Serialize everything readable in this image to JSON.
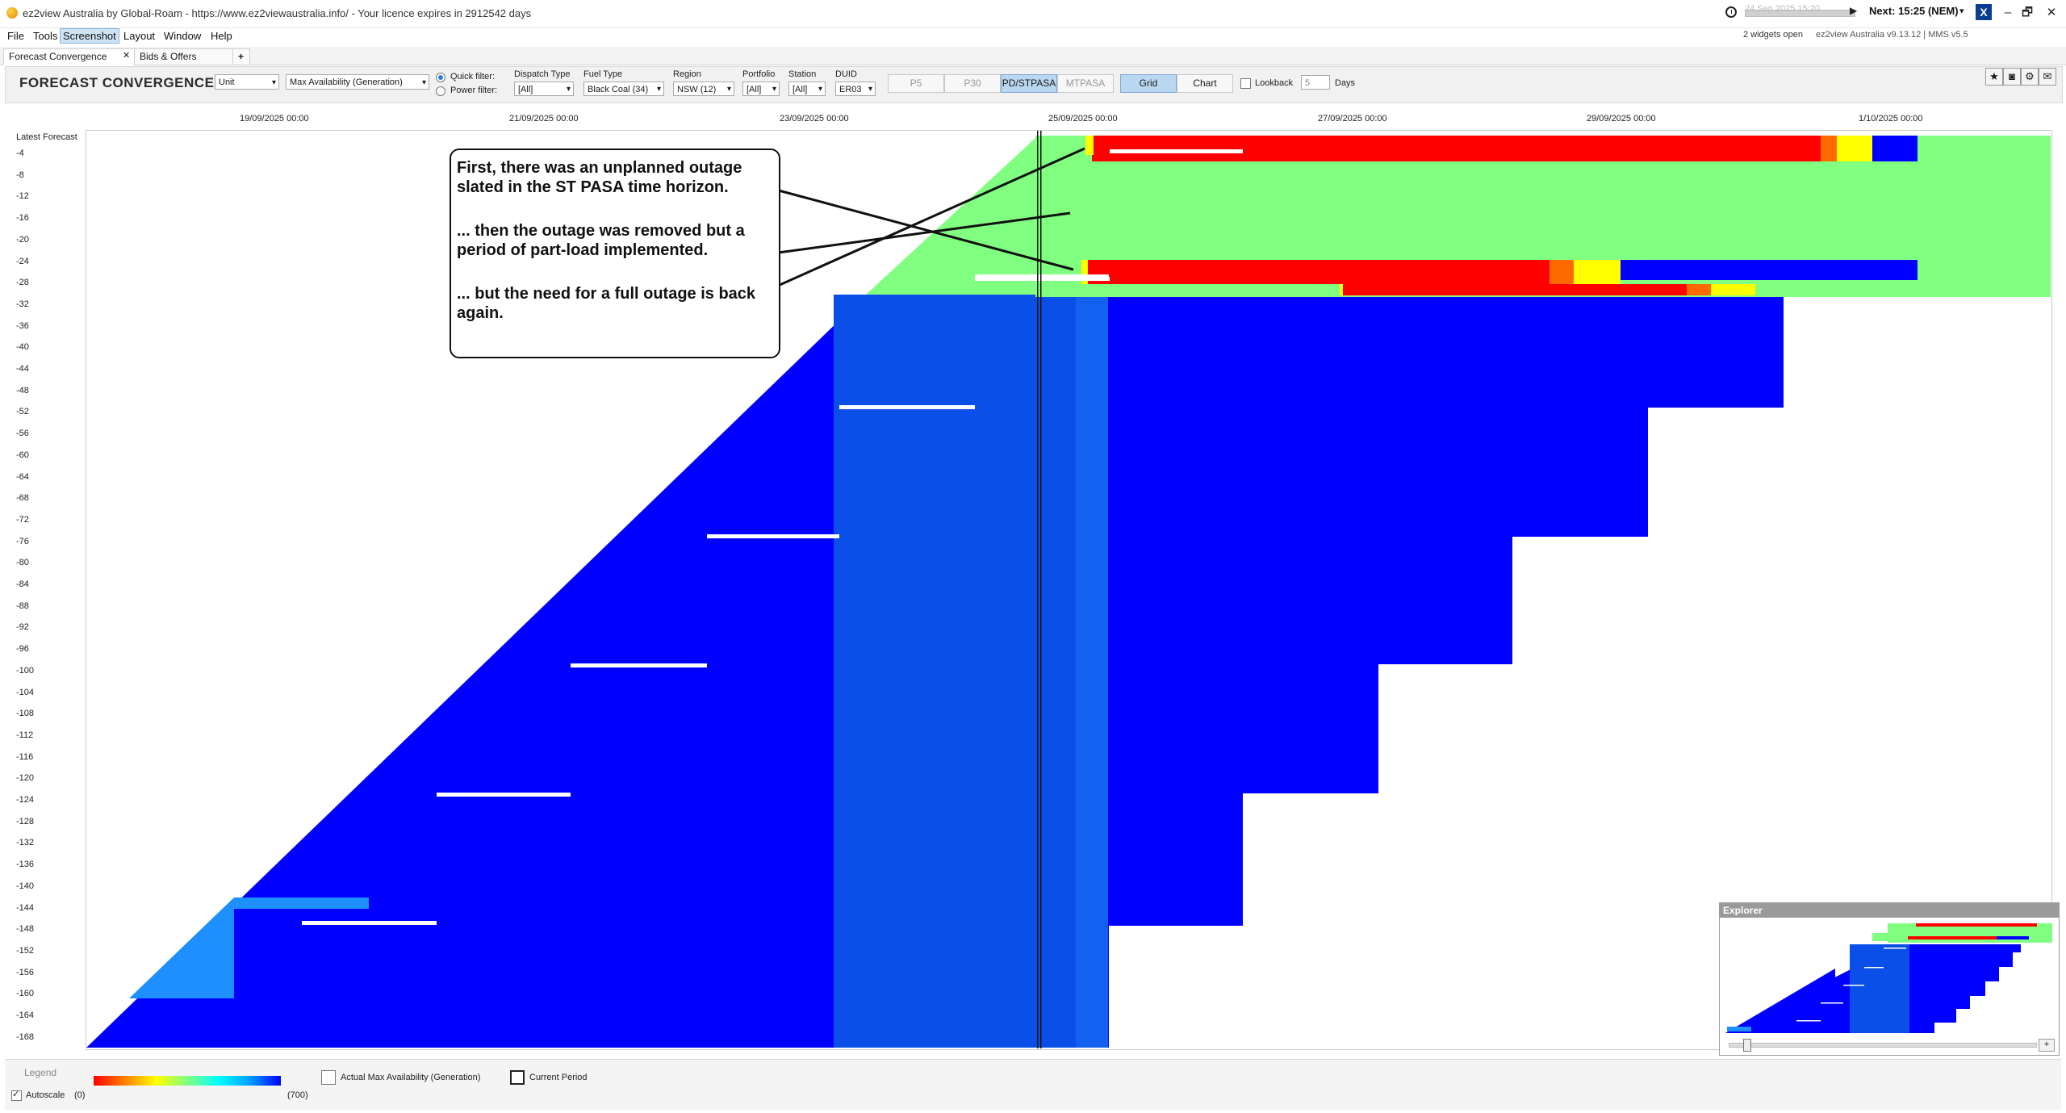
{
  "window": {
    "title": "ez2view Australia by Global-Roam - https://www.ez2viewaustralia.info/ - Your licence expires in 2912542 days",
    "time_slider_label": "24 Sep 2025 15:20",
    "next_label": "Next: 15:25 (NEM)",
    "widgets_open": "2 widgets open",
    "version": "ez2view Australia v9.13.12 | MMS v5.5",
    "controls": {
      "minimize": "–",
      "restore": "🗗",
      "close": "✕"
    }
  },
  "menu": [
    "File",
    "Tools",
    "Screenshot",
    "Layout",
    "Window",
    "Help"
  ],
  "tabs": [
    {
      "label": "Forecast Convergence",
      "close": "✕"
    },
    {
      "label": "Bids & Offers"
    },
    {
      "label": "+"
    }
  ],
  "toolbar": {
    "title": "FORECAST CONVERGENCE",
    "level_select": "Unit",
    "metric_select": "Max Availability (Generation)",
    "quick_filter_label": "Quick filter:",
    "power_filter_label": "Power filter:",
    "filters": [
      {
        "label": "Dispatch Type",
        "value": "[All]"
      },
      {
        "label": "Fuel Type",
        "value": "Black Coal (34)"
      },
      {
        "label": "Region",
        "value": "NSW (12)"
      },
      {
        "label": "Portfolio",
        "value": "[All]"
      },
      {
        "label": "Station",
        "value": "[All]"
      },
      {
        "label": "DUID",
        "value": "ER03"
      }
    ],
    "horizon_buttons": [
      "P5",
      "P30",
      "PD/STPASA",
      "MTPASA"
    ],
    "horizon_selected": "PD/STPASA",
    "view_buttons": [
      "Grid",
      "Chart"
    ],
    "view_selected": "Grid",
    "lookback_label": "Lookback",
    "lookback_value": "5",
    "days_label": "Days",
    "icons": [
      "star-icon",
      "camera-icon",
      "settings-icon",
      "comment-icon"
    ]
  },
  "chart_data": {
    "type": "heatmap",
    "title": "",
    "x_ticks": [
      "19/09/2025 00:00",
      "21/09/2025 00:00",
      "23/09/2025 00:00",
      "25/09/2025 00:00",
      "27/09/2025 00:00",
      "29/09/2025 00:00",
      "1/10/2025 00:00"
    ],
    "y_header": "Latest Forecast",
    "y_ticks": [
      "-4",
      "-8",
      "-12",
      "-16",
      "-20",
      "-24",
      "-28",
      "-32",
      "-36",
      "-40",
      "-44",
      "-48",
      "-52",
      "-56",
      "-60",
      "-64",
      "-68",
      "-72",
      "-76",
      "-80",
      "-84",
      "-88",
      "-92",
      "-96",
      "-100",
      "-104",
      "-108",
      "-112",
      "-116",
      "-120",
      "-124",
      "-128",
      "-132",
      "-136",
      "-140",
      "-144",
      "-148",
      "-152",
      "-156",
      "-160",
      "-164",
      "-168"
    ],
    "color_scale": {
      "min": 0,
      "max": 700,
      "colors": [
        "#ff0000",
        "#ff8000",
        "#ffff00",
        "#80ff80",
        "#00ffff",
        "#00a0ff",
        "#0000ff"
      ]
    },
    "zones": [
      {
        "description": "ST PASA green part-load period",
        "value_approx": 300
      },
      {
        "description": "full outage red periods",
        "value_approx": 0
      },
      {
        "description": "normal availability",
        "value_approx": 700
      }
    ]
  },
  "annotation": {
    "line1": "First, there was an unplanned outage slated in the ST PASA time horizon.",
    "line2": "... then the outage was removed but a period of part-load implemented.",
    "line3": "... but the need for a full outage is back again."
  },
  "explorer": {
    "title": "Explorer"
  },
  "legend": {
    "label": "Legend",
    "min_label": "(0)",
    "max_label": "(700)",
    "autoscale_label": "Autoscale",
    "actual_label": "Actual Max Availability (Generation)",
    "current_label": "Current Period"
  }
}
